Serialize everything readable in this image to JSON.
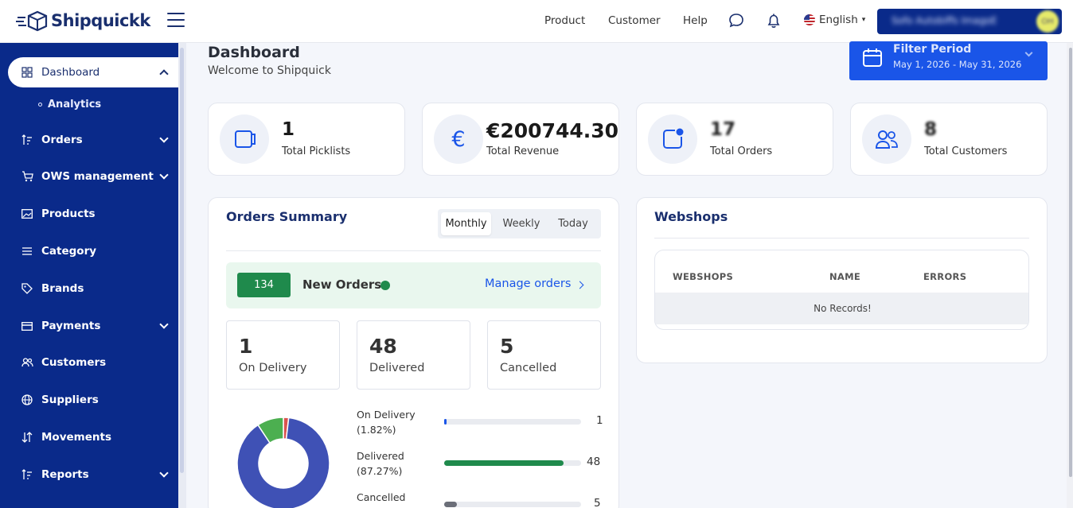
{
  "app": {
    "name": "Shipquickk"
  },
  "topnav": {
    "items": [
      "Product",
      "Customer",
      "Help"
    ],
    "language": "English",
    "user_name": "Sofo Autobiffs ImagoE",
    "user_initials": "OH"
  },
  "sidebar": {
    "items": [
      {
        "label": "Dashboard",
        "icon": "grid-icon",
        "expanded": true
      },
      {
        "label": "Orders",
        "icon": "sort-icon"
      },
      {
        "label": "OWS management",
        "icon": "cart-icon"
      },
      {
        "label": "Products",
        "icon": "image-icon"
      },
      {
        "label": "Category",
        "icon": "list-icon"
      },
      {
        "label": "Brands",
        "icon": "tag-icon"
      },
      {
        "label": "Payments",
        "icon": "card-icon"
      },
      {
        "label": "Customers",
        "icon": "users-icon"
      },
      {
        "label": "Suppliers",
        "icon": "globe-icon"
      },
      {
        "label": "Movements",
        "icon": "arrows-icon"
      },
      {
        "label": "Reports",
        "icon": "sort-icon"
      }
    ],
    "submenu": {
      "label": "Analytics"
    }
  },
  "header": {
    "title": "Dashboard",
    "subtitle": "Welcome to Shipquick"
  },
  "filter": {
    "title": "Filter Period",
    "range": "May 1, 2026 - May 31, 2026"
  },
  "stats": [
    {
      "value": "1",
      "label": "Total Picklists",
      "icon": "clipboard-icon"
    },
    {
      "value": "€200744.30",
      "label": "Total Revenue",
      "icon": "euro-icon"
    },
    {
      "value": "17",
      "label": "Total Orders",
      "icon": "notification-icon"
    },
    {
      "value": "8",
      "label": "Total Customers",
      "icon": "users-icon"
    }
  ],
  "orders_summary": {
    "title": "Orders Summary",
    "tabs": [
      "Monthly",
      "Weekly",
      "Today"
    ],
    "selected_tab": "Monthly",
    "new_orders": {
      "count": "134",
      "label": "New Orders",
      "link": "Manage orders"
    },
    "counts": [
      {
        "value": "1",
        "label": "On Delivery"
      },
      {
        "value": "48",
        "label": "Delivered"
      },
      {
        "value": "5",
        "label": "Cancelled"
      }
    ],
    "bars": [
      {
        "label": "On Delivery",
        "pct": "(1.82%)",
        "value": "1",
        "fraction": 0.018,
        "color": "#1a55e8"
      },
      {
        "label": "Delivered",
        "pct": "(87.27%)",
        "value": "48",
        "fraction": 0.8727,
        "color": "#1f8a4c"
      },
      {
        "label": "Cancelled",
        "pct": "",
        "value": "5",
        "fraction": 0.0909,
        "color": "#6b6e78"
      }
    ]
  },
  "chart_data": {
    "type": "pie",
    "categories": [
      "On Delivery",
      "Delivered",
      "Cancelled"
    ],
    "values": [
      1,
      48,
      5
    ],
    "colors": [
      "#d9534f",
      "#3f51b5",
      "#4caf50"
    ]
  },
  "webshops": {
    "title": "Webshops",
    "columns": [
      "WEBSHOPS",
      "NAME",
      "ERRORS"
    ],
    "empty": "No Records!"
  },
  "colors": {
    "sidebar": "#0a2a8a",
    "accent": "#1a55e8",
    "success": "#1f8a4c"
  }
}
